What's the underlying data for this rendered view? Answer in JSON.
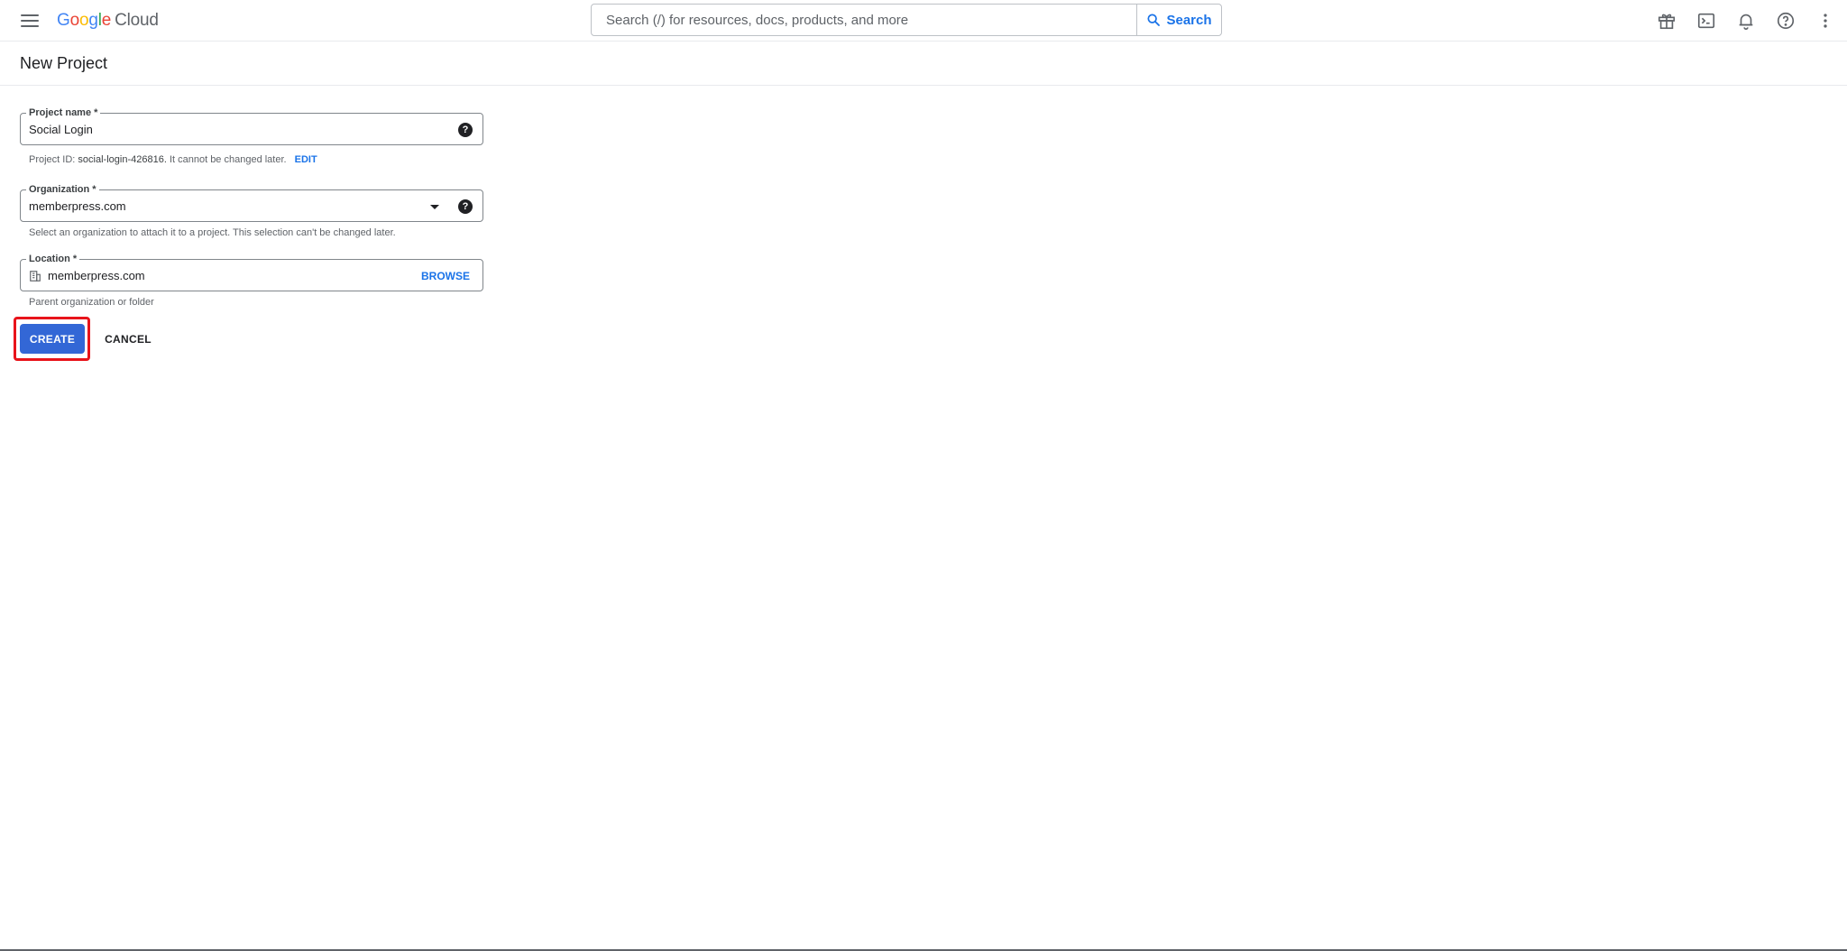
{
  "header": {
    "logo_google": "Google",
    "logo_cloud": "Cloud",
    "search_placeholder": "Search (/) for resources, docs, products, and more",
    "search_button": "Search",
    "icons": [
      "gift-icon",
      "terminal-icon",
      "bell-icon",
      "help-circle-icon",
      "more-vert-icon"
    ]
  },
  "page": {
    "title": "New Project"
  },
  "form": {
    "project_name": {
      "label": "Project name *",
      "value": "Social Login"
    },
    "project_id_hint": {
      "prefix": "Project ID:",
      "id": "social-login-426816.",
      "suffix": "It cannot be changed later.",
      "edit": "EDIT"
    },
    "organization": {
      "label": "Organization *",
      "value": "memberpress.com",
      "hint": "Select an organization to attach it to a project. This selection can't be changed later."
    },
    "location": {
      "label": "Location *",
      "value": "memberpress.com",
      "browse": "BROWSE",
      "hint": "Parent organization or folder"
    }
  },
  "actions": {
    "create": "CREATE",
    "cancel": "CANCEL"
  },
  "colors": {
    "primary": "#3367d6",
    "link": "#1a73e8",
    "highlight": "#e8141b"
  }
}
